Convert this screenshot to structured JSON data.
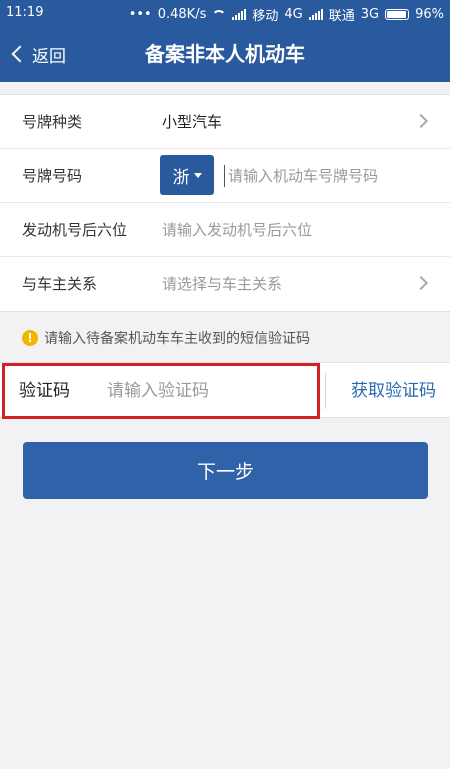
{
  "status_bar": {
    "time": "11:19",
    "dots": "•••",
    "speed": "0.48K/s",
    "carrier1": "移动",
    "network1": "4G",
    "carrier2": "联通",
    "network2": "3G",
    "battery": "96%"
  },
  "nav": {
    "back_label": "返回",
    "title": "备案非本人机动车"
  },
  "form": {
    "plate_type_label": "号牌种类",
    "plate_type_value": "小型汽车",
    "plate_number_label": "号牌号码",
    "province_value": "浙",
    "plate_number_placeholder": "请输入机动车号牌号码",
    "engine_label": "发动机号后六位",
    "engine_placeholder": "请输入发动机号后六位",
    "relation_label": "与车主关系",
    "relation_placeholder": "请选择与车主关系"
  },
  "notice": {
    "icon": "!",
    "text": "请输入待备案机动车车主收到的短信验证码"
  },
  "verify": {
    "label": "验证码",
    "placeholder": "请输入验证码",
    "get_code": "获取验证码"
  },
  "next_button": "下一步",
  "colors": {
    "primary": "#2a5a9e",
    "highlight_border": "#d32026",
    "link": "#2a68b0",
    "warning": "#f3b400"
  }
}
